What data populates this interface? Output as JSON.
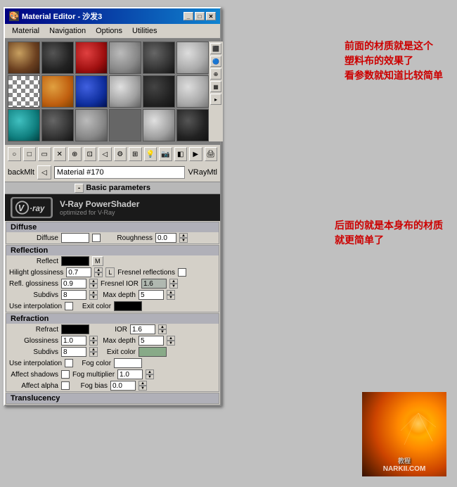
{
  "window": {
    "title": "Material Editor - 沙发3",
    "icon": "material-editor-icon"
  },
  "menu": {
    "items": [
      "Material",
      "Navigation",
      "Options",
      "Utilities"
    ]
  },
  "materials": {
    "grid": [
      "mat-brown",
      "mat-dark",
      "mat-red",
      "mat-gray",
      "mat-dark2",
      "mat-white",
      "mat-checker",
      "mat-orange",
      "mat-blue",
      "mat-silver",
      "mat-dark3",
      "mat-lightgray",
      "mat-teal",
      "mat-dark2",
      "mat-empty",
      "mat-empty",
      "mat-lightgray",
      "mat-dark"
    ]
  },
  "material_name_row": {
    "back_label": "backMlt",
    "mat_icon": "◁",
    "name": "Material #170",
    "type_label": "VRayMtl"
  },
  "section_header": "Basic parameters",
  "vray": {
    "logo_text": "V·RAY",
    "logo_v": "⊙",
    "title": "V-Ray PowerShader",
    "subtitle": "optimized for V-Ray"
  },
  "diffuse": {
    "label": "Diffuse",
    "roughness_label": "Roughness",
    "roughness_value": "0.0"
  },
  "reflection": {
    "section_label": "Reflection",
    "reflect_label": "Reflect",
    "m_button": "M",
    "hilight_label": "Hilight glossiness",
    "hilight_value": "0.7",
    "l_button": "L",
    "fresnel_label": "Fresnel reflections",
    "refl_gloss_label": "Refl. glossiness",
    "refl_gloss_value": "0.9",
    "fresnel_ior_label": "Fresnel IOR",
    "fresnel_ior_value": "1.6",
    "subdivs_label": "Subdivs",
    "subdivs_value": "8",
    "max_depth_label": "Max depth",
    "max_depth_value": "5",
    "use_interp_label": "Use interpolation",
    "exit_color_label": "Exit color"
  },
  "refraction": {
    "section_label": "Refraction",
    "refract_label": "Refract",
    "ior_label": "IOR",
    "ior_value": "1.6",
    "glossiness_label": "Glossiness",
    "glossiness_value": "1.0",
    "max_depth_label": "Max depth",
    "max_depth_value": "5",
    "subdivs_label": "Subdivs",
    "subdivs_value": "8",
    "exit_color_label": "Exit color",
    "use_interp_label": "Use interpolation",
    "fog_color_label": "Fog color",
    "affect_shadows_label": "Affect shadows",
    "fog_mult_label": "Fog multiplier",
    "fog_mult_value": "1.0",
    "affect_alpha_label": "Affect alpha",
    "fog_bias_label": "Fog bias",
    "fog_bias_value": "0.0"
  },
  "translucency": {
    "section_label": "Translucency"
  },
  "annotations": {
    "text1_line1": "前面的材质就是这个",
    "text1_line2": "塑料布的效果了",
    "text1_line3": "看参数就知道比较简单",
    "text2_line1": "后面的就是本身布的材质",
    "text2_line2": "就更简单了"
  },
  "watermark": {
    "site1": "教程",
    "site2": "NARKII.COM"
  }
}
